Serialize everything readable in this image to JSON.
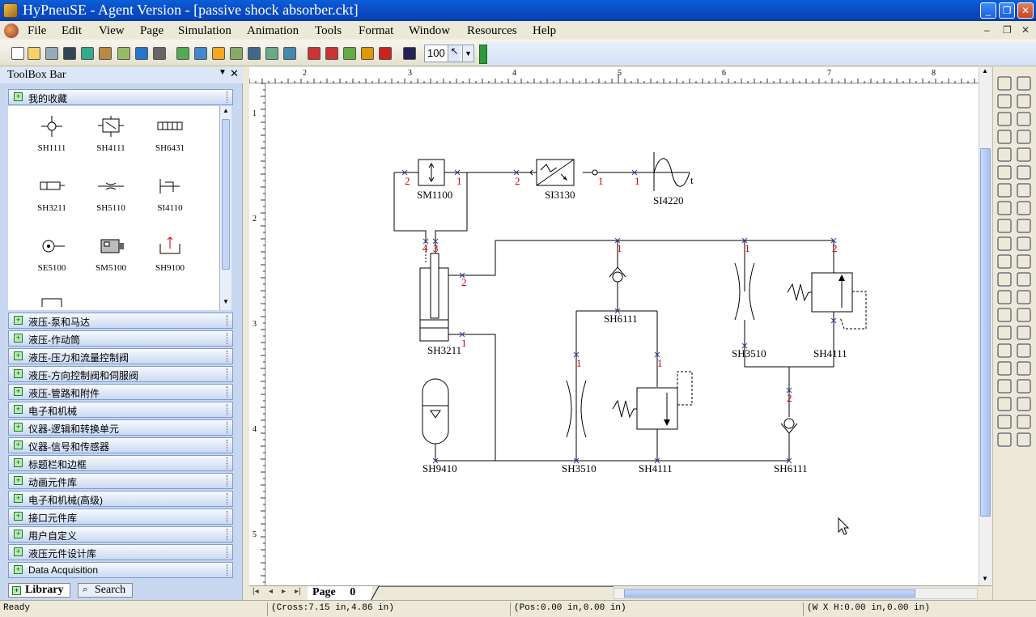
{
  "window": {
    "title": "HyPneuSE - Agent Version - [passive shock absorber.ckt]",
    "controls": {
      "minimize": "_",
      "restore": "❐",
      "close": "✕"
    }
  },
  "menu": [
    "File",
    "Edit",
    "View",
    "Page",
    "Simulation",
    "Animation",
    "Tools",
    "Format",
    "Window",
    "Resources",
    "Help"
  ],
  "toolbar": {
    "zoom_value": "100"
  },
  "toolbox": {
    "title": "ToolBox Bar",
    "favorites_label": "我的收藏",
    "components": [
      {
        "id": "SH1111",
        "icon": "junction-icon"
      },
      {
        "id": "SH4111",
        "icon": "valve-icon"
      },
      {
        "id": "SH6431",
        "icon": "block-icon"
      },
      {
        "id": "SH3211",
        "icon": "cylinder-icon"
      },
      {
        "id": "SH5110",
        "icon": "restrictor-icon"
      },
      {
        "id": "SI4110",
        "icon": "sensor-icon"
      },
      {
        "id": "SE5100",
        "icon": "motor-icon"
      },
      {
        "id": "SM5100",
        "icon": "machine-icon"
      },
      {
        "id": "SH9100",
        "icon": "tank-icon"
      }
    ],
    "categories": [
      "液压-泵和马达",
      "液压-作动筒",
      "液压-压力和流量控制阀",
      "液压-方向控制阀和伺服阀",
      "液压-管路和附件",
      "电子和机械",
      "仪器-逻辑和转换单元",
      "仪器-信号和传感器",
      "标题栏和边框",
      "动画元件库",
      "电子和机械(高级)",
      "接口元件库",
      "用户自定义",
      "液压元件设计库",
      "Data Acquisition"
    ],
    "tabs": [
      "Library",
      "Search"
    ]
  },
  "rulers": {
    "top": [
      "2",
      "3",
      "4",
      "5",
      "6",
      "7",
      "8"
    ],
    "left": [
      "1",
      "2",
      "3",
      "4",
      "5"
    ]
  },
  "circuit": {
    "labels": {
      "sm1100": "SM1100",
      "si3130": "SI3130",
      "si4220": "SI4220",
      "si4220_t": "t",
      "sh3211": "SH3211",
      "sh6111_a": "SH6111",
      "sh3510_a": "SH3510",
      "sh4111_a": "SH4111",
      "sh9410": "SH9410",
      "sh3510_b": "SH3510",
      "sh4111_b": "SH4111",
      "sh6111_b": "SH6111"
    },
    "ports": {
      "p_sm_2": "2",
      "p_sm_1": "1",
      "p_si31_2": "2",
      "p_si31_1": "1",
      "p_si42_1": "1",
      "p_cyl_4": "4",
      "p_cyl_3": "3",
      "p_cyl_2": "2",
      "p_cyl_1": "1",
      "p_cv1_1": "1",
      "p_r1_1": "1",
      "p_rv1_1": "1",
      "p_r2_1": "1",
      "p_rv2_2": "2",
      "p_cv2_2": "2"
    }
  },
  "page_tab": {
    "label": "Page",
    "number": "0"
  },
  "status": {
    "ready": "Ready",
    "cross": "(Cross:7.15 in,4.86 in)",
    "pos": "(Pos:0.00 in,0.00 in)",
    "size": "(W X H:0.00 in,0.00 in)"
  }
}
